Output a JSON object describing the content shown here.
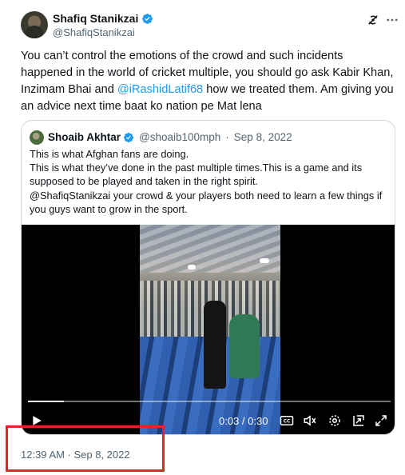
{
  "author": {
    "name": "Shafiq Stanikzai",
    "handle": "@ShafiqStanikzai",
    "verified": true
  },
  "tweet": {
    "text_before": "You can’t control the emotions of the crowd and such incidents happened in the world of cricket multiple, you should go ask Kabir Khan, Inzimam Bhai and ",
    "mention": "@iRashidLatif68",
    "text_after": " how we treated them. Am giving you an advice next time baat ko nation pe Mat lena"
  },
  "quote": {
    "name": "Shoaib Akhtar",
    "handle": "@shoaib100mph",
    "separator": "·",
    "date": "Sep 8, 2022",
    "lines": [
      "This is what Afghan fans are doing.",
      "This is what they’ve done in the past multiple times.This is a game and its supposed to be played and taken in the right spirit.",
      "@ShafiqStanikzai your crowd & your players both need to learn a few things if you guys want to grow in the sport."
    ]
  },
  "video": {
    "time": "0:03 / 0:30",
    "progress": 0.1
  },
  "timestamp": "12:39 AM · Sep 8, 2022",
  "colors": {
    "accent": "#1d9bf0",
    "secondary_text": "#536471",
    "highlight_box": "#e8202a"
  },
  "icons": [
    "verified-badge-icon",
    "grok-icon",
    "more-icon",
    "play-icon",
    "captions-icon",
    "volume-icon",
    "settings-gear-icon",
    "picture-in-picture-icon",
    "fullscreen-icon"
  ]
}
